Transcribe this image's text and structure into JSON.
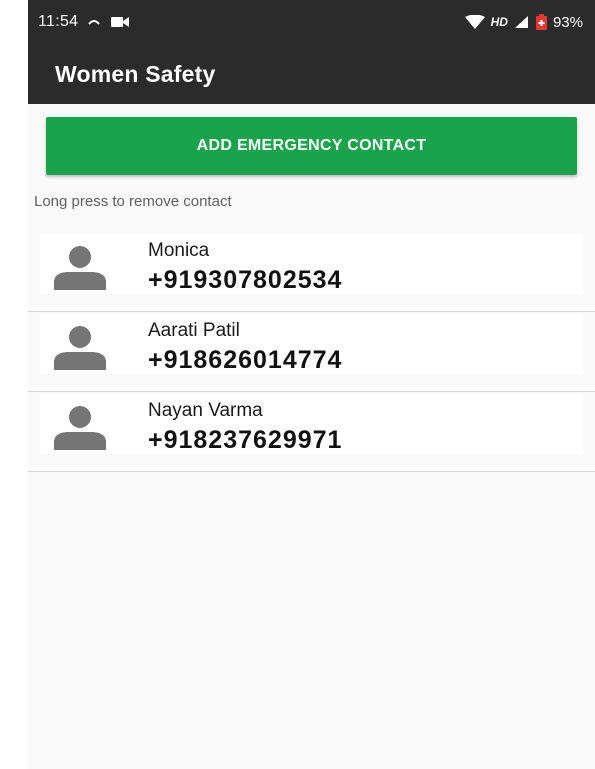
{
  "status_bar": {
    "time": "11:54",
    "network_label": "HD",
    "battery": "93%"
  },
  "app_bar": {
    "title": "Women Safety"
  },
  "add_button": {
    "label": "ADD EMERGENCY CONTACT",
    "color": "#1ba24d"
  },
  "hint": "Long press to remove contact",
  "contacts": [
    {
      "name": "Monica",
      "phone": "+919307802534",
      "icon": "person-icon"
    },
    {
      "name": "Aarati Patil",
      "phone": "+918626014774",
      "icon": "person-icon"
    },
    {
      "name": "Nayan Varma",
      "phone": "+918237629971",
      "icon": "person-icon"
    }
  ],
  "colors": {
    "app_bar": "#2b2b2b",
    "accent": "#1ba24d",
    "background": "#fafafa"
  }
}
